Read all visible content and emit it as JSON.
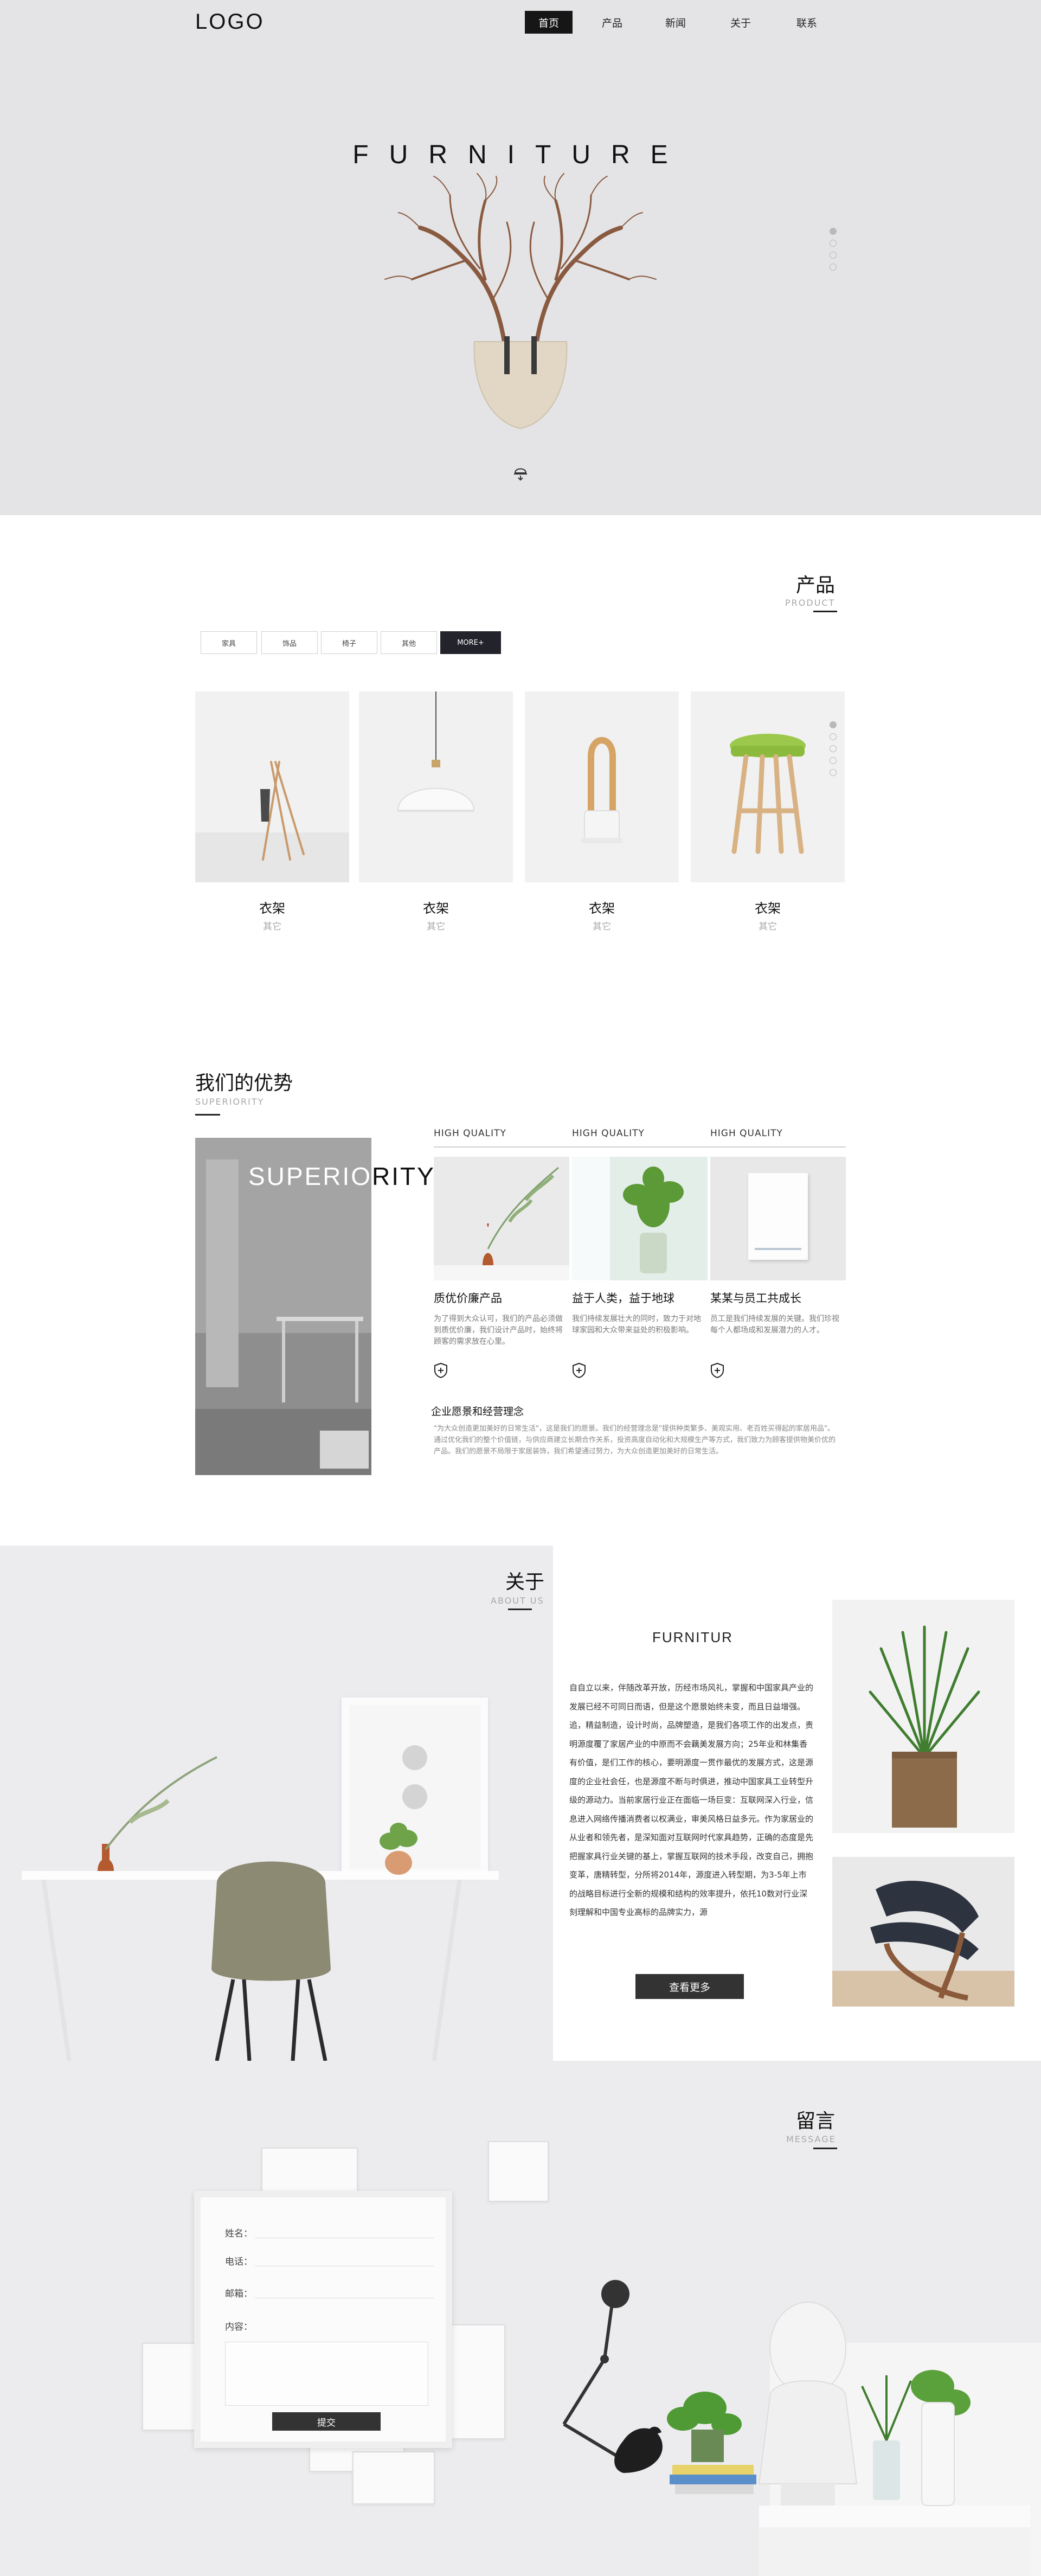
{
  "header": {
    "logo": "LOGO",
    "nav": [
      {
        "label": "首页",
        "active": true
      },
      {
        "label": "产品",
        "active": false
      },
      {
        "label": "新闻",
        "active": false
      },
      {
        "label": "关于",
        "active": false
      },
      {
        "label": "联系",
        "active": false
      }
    ]
  },
  "hero": {
    "title": "FURNITURE",
    "slides": 4,
    "active_slide": 1
  },
  "product": {
    "title_cn": "产品",
    "title_en": "PRODUCT",
    "tabs": [
      "家具",
      "饰品",
      "椅子",
      "其他",
      "MORE+"
    ],
    "items": [
      {
        "name": "衣架",
        "sub": "其它"
      },
      {
        "name": "衣架",
        "sub": "其它"
      },
      {
        "name": "衣架",
        "sub": "其它"
      },
      {
        "name": "衣架",
        "sub": "其它"
      }
    ]
  },
  "superiority": {
    "title_cn": "我们的优势",
    "title_en": "SUPERIORITY",
    "overlay_text": "SUPERIORITY",
    "labels": [
      "HIGH QUALITY",
      "HIGH QUALITY",
      "HIGH QUALITY"
    ],
    "features": [
      {
        "title": "质优价廉产品",
        "text": "为了得到大众认可，我们的产品必须做到质优价廉，我们设计产品时，始终将顾客的需求放在心里。"
      },
      {
        "title": "益于人类，益于地球",
        "text": "我们持续发展壮大的同时，致力于对地球家园和大众带来益处的积极影响。"
      },
      {
        "title": "某某与员工共成长",
        "text": "员工是我们持续发展的关键。我们珍视每个人都场成和发展潜力的人才。"
      }
    ],
    "vision_title": "企业愿景和经营理念",
    "vision_text": "\"为大众创造更加美好的日常生活\"，这是我们的愿景。我们的经营理念是\"提供种类繁多、美观实用、老百姓买得起的家居用品\"。通过优化我们的整个价值链，与供应商建立长期合作关系，投资高度自动化和大规模生产等方式，我们致力为顾客提供物美价优的产品。我们的愿景不局限于家居装饰，我们希望通过努力，为大众创造更加美好的日常生活。"
  },
  "about": {
    "title_cn": "关于",
    "title_en": "ABOUT US",
    "heading": "FURNITUR",
    "paragraph": "自自立以来，伴随改革开放，历经市场风礼，掌握和中国家具产业的发展已经不可同日而语，但是这个愿景始终未变，而且日益增强。追，精益制造，设计时尚，品牌塑造，是我们各项工作的出发点，责明源度覆了家居产业的中原而不会藕美发展方向；25年业和林集香有价值，是们工作的核心，要明源度一贯作最优的发展方式，这是源度的企业社会任，也是源度不断与时俱进，推动中国家具工业转型升级的源动力。当前家居行业正在面临一场巨变：互联网深入行业，信息进入网络传播消费者以权满业，审美风格日益多元。作为家居业的从业者和领先者，是深知面对互联网时代家具趋势，正确的态度是先把握家具行业关键的基上，掌握互联网的技术手段，改变自己，拥抱变革，唐精转型，分所将2014年，源度进入转型期，为3-5年上市的战略目标进行全新的规模和结构的效率提升，依托10数对行业深刻理解和中国专业高标的品牌实力，源",
    "more_button": "查看更多"
  },
  "message": {
    "title_cn": "留言",
    "title_en": "MESSAGE",
    "fields": [
      "姓名：",
      "电话：",
      "邮箱：",
      "内容："
    ],
    "submit": "提交"
  },
  "colors": {
    "hero_bg": "#e4e4e6",
    "dark": "#161616",
    "button": "#333333",
    "accent_line": "#222222"
  }
}
